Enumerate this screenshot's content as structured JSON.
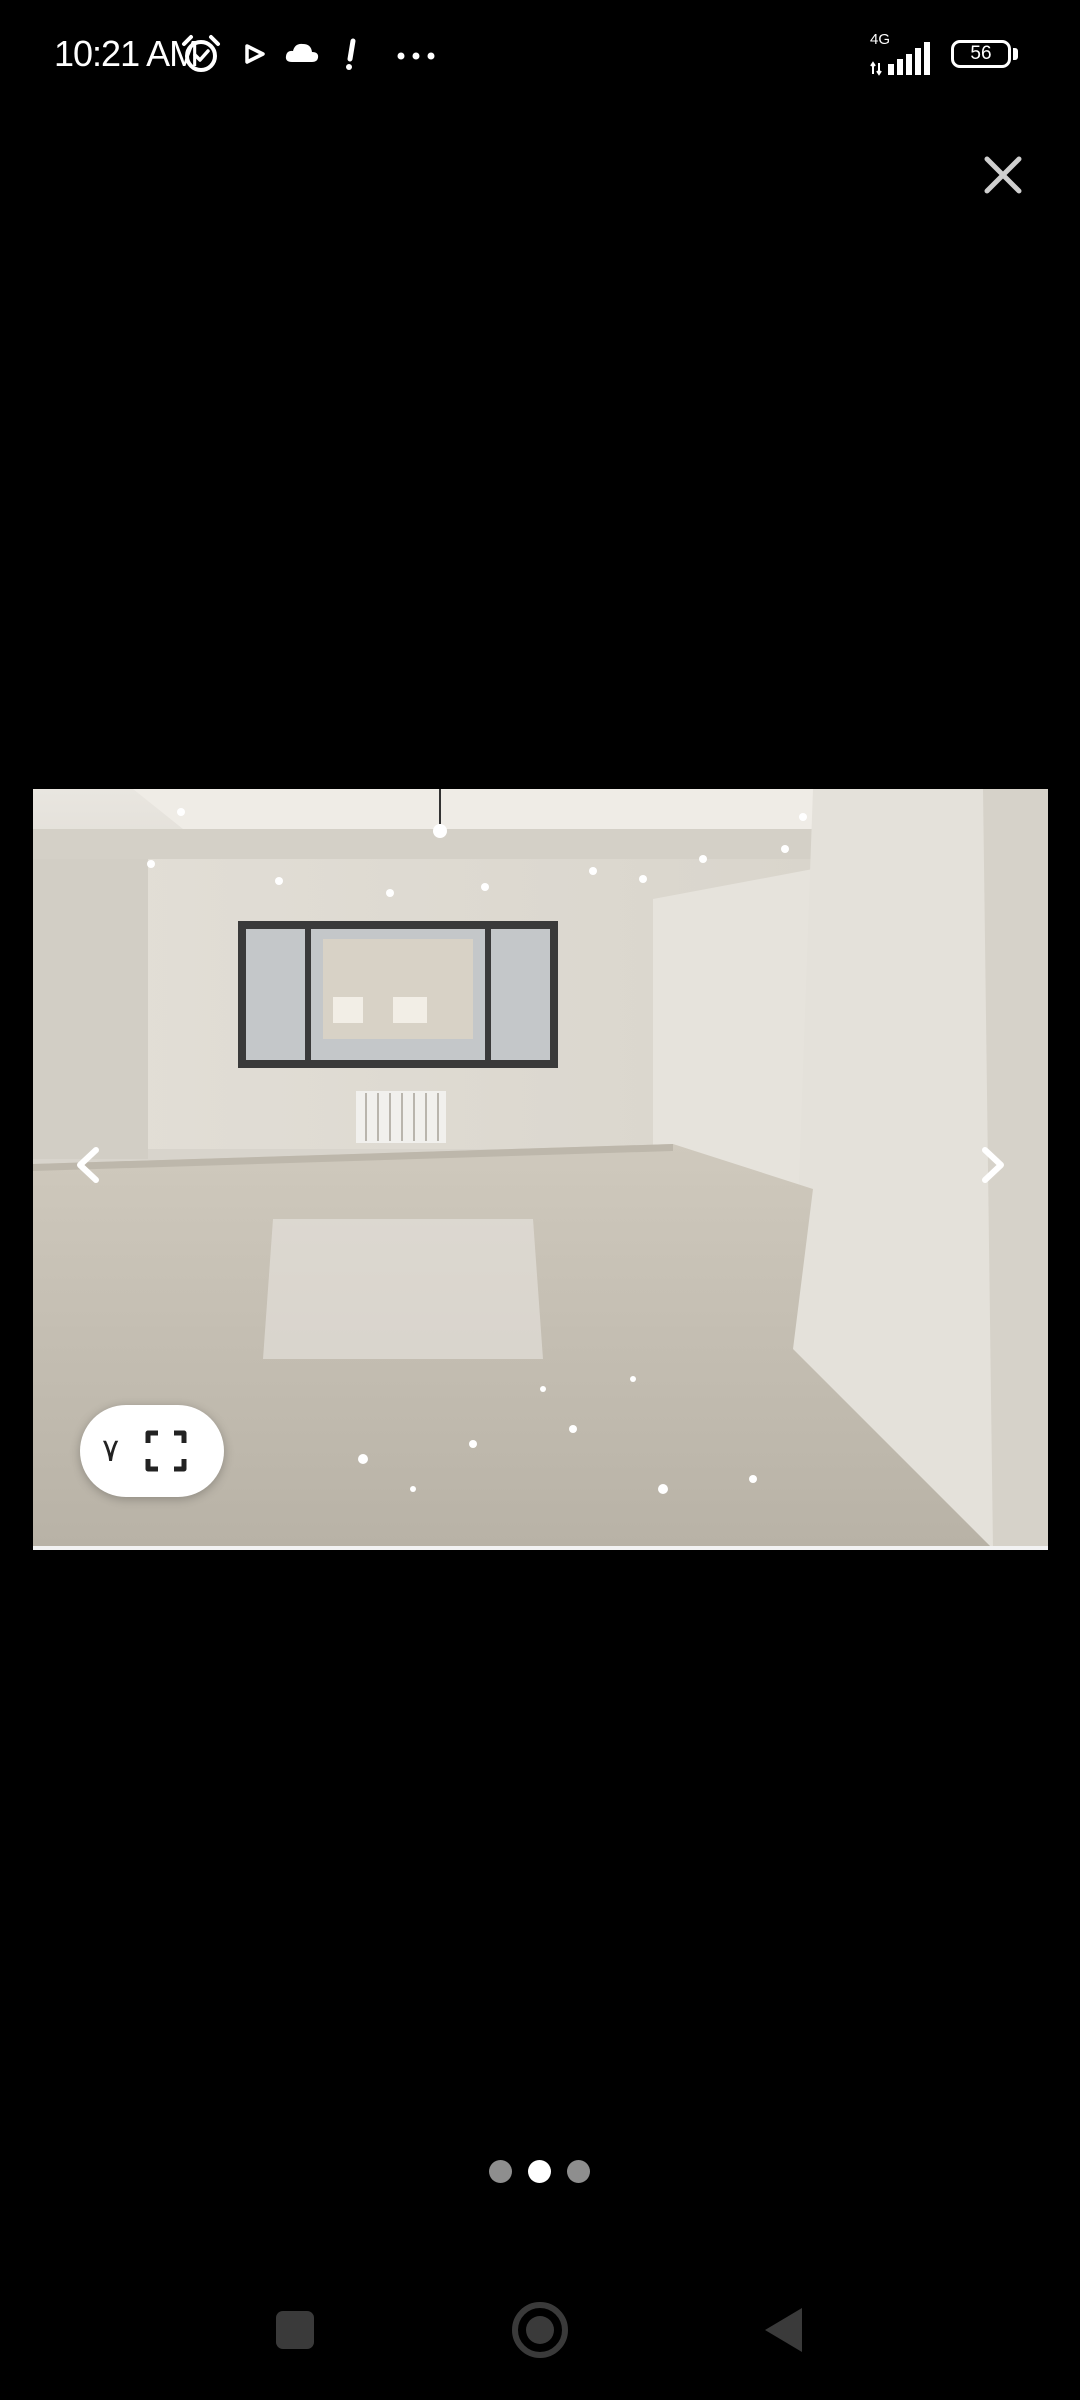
{
  "status_bar": {
    "time": "10:21 AM",
    "network_type": "4G",
    "battery_level": "56",
    "icons": [
      "alarm-icon",
      "play-icon",
      "cloud-icon",
      "alert-icon",
      "more-dots-icon",
      "signal-icon",
      "battery-icon"
    ]
  },
  "viewer": {
    "close_icon": "close-icon",
    "prev_icon": "chevron-left-icon",
    "next_icon": "chevron-right-icon",
    "photo_description_icon": "room-photo",
    "photo_count": "۷",
    "expand_icon": "fullscreen-icon"
  },
  "pagination": {
    "total": 3,
    "active_index": 1
  },
  "nav_bar": {
    "icons": [
      "recents-square-icon",
      "home-circle-icon",
      "back-triangle-icon"
    ]
  },
  "colors": {
    "background": "#000000",
    "dot_inactive": "#8e8e8e",
    "dot_active": "#ffffff",
    "nav_button": "#3a3a3a"
  }
}
